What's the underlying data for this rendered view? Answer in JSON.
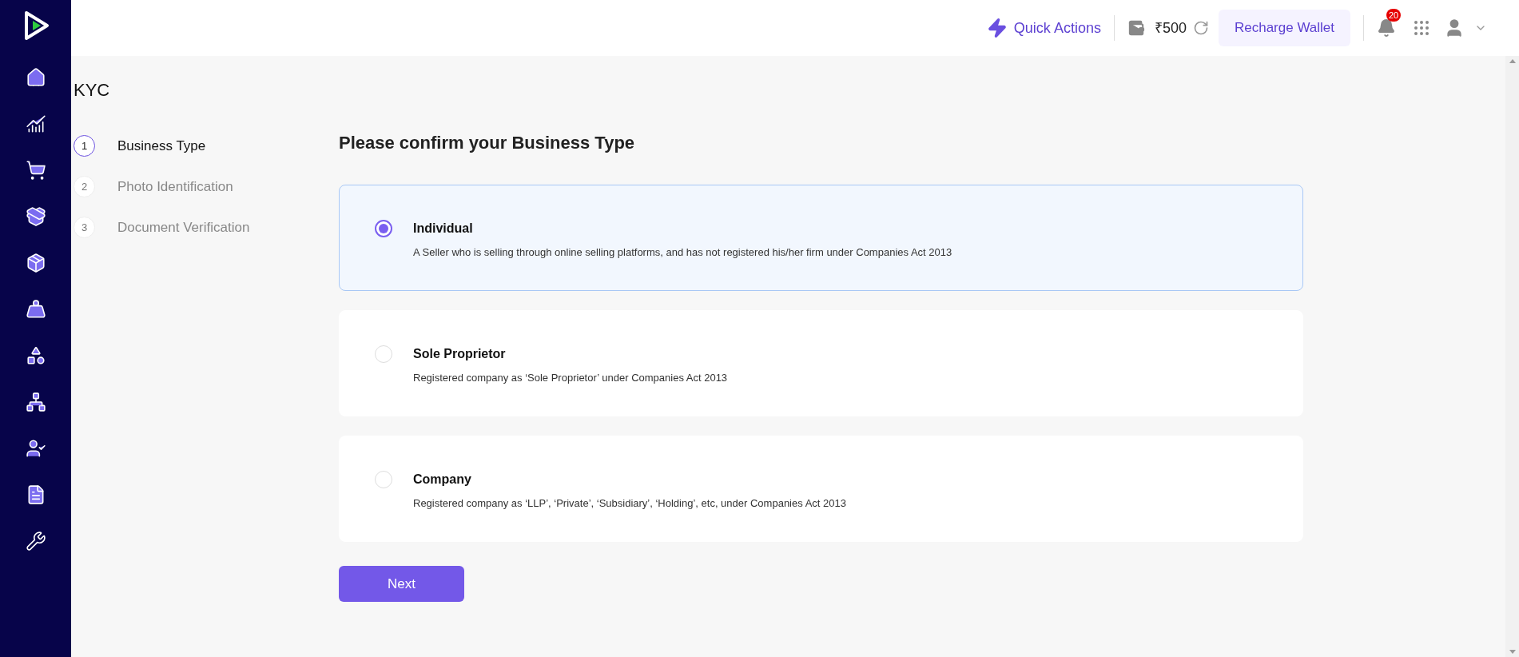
{
  "header": {
    "quick_actions": "Quick Actions",
    "wallet_balance": "₹500",
    "recharge_button": "Recharge Wallet",
    "notification_count": "20"
  },
  "page_title": "KYC",
  "steps": [
    {
      "number": "1",
      "label": "Business Type",
      "selected": true
    },
    {
      "number": "2",
      "label": "Photo Identification",
      "selected": false
    },
    {
      "number": "3",
      "label": "Document Verification",
      "selected": false
    }
  ],
  "form": {
    "title": "Please confirm your Business Type",
    "options": [
      {
        "title": "Individual",
        "description": "A Seller who is selling through online selling platforms, and has not registered his/her firm under Companies Act 2013",
        "selected": true
      },
      {
        "title": "Sole Proprietor",
        "description": "Registered company as ‘Sole Proprietor’ under Companies Act 2013",
        "selected": false
      },
      {
        "title": "Company",
        "description": "Registered company as ‘LLP’, ‘Private’, ‘Subsidiary’, ‘Holding’, etc, under Companies Act 2013",
        "selected": false
      }
    ],
    "next_button": "Next"
  }
}
